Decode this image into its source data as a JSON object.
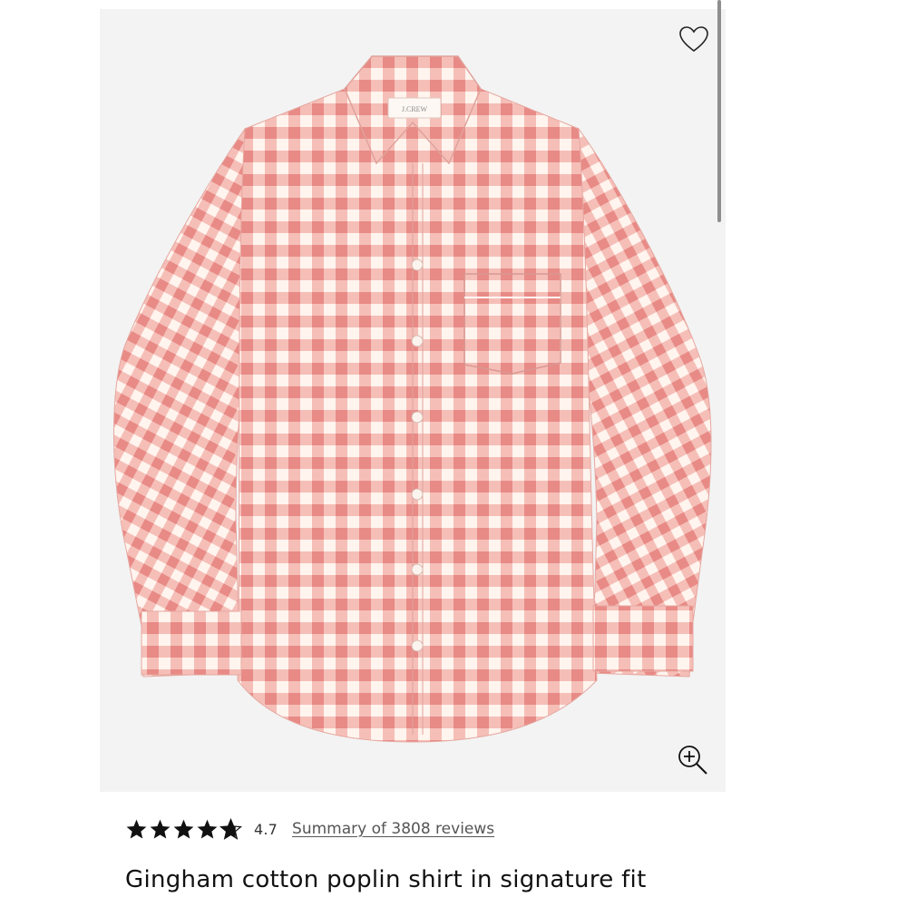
{
  "product": {
    "brand_label": "J.CREW",
    "title": "Gingham cotton poplin shirt in signature fit",
    "rating": 4.7,
    "rating_text": "4.7",
    "reviews_link": "Summary of 3808 reviews",
    "image_alt": "Pink gingham button-down shirt"
  },
  "icons": {
    "wishlist": "heart-icon",
    "zoom": "zoom-in-icon",
    "star": "star-icon"
  },
  "colors": {
    "gingham_dark": "#e88a86",
    "gingham_light": "#f6c9c3",
    "gingham_white": "#fff4ee",
    "image_bg": "#f3f3f3",
    "star": "#111111"
  }
}
